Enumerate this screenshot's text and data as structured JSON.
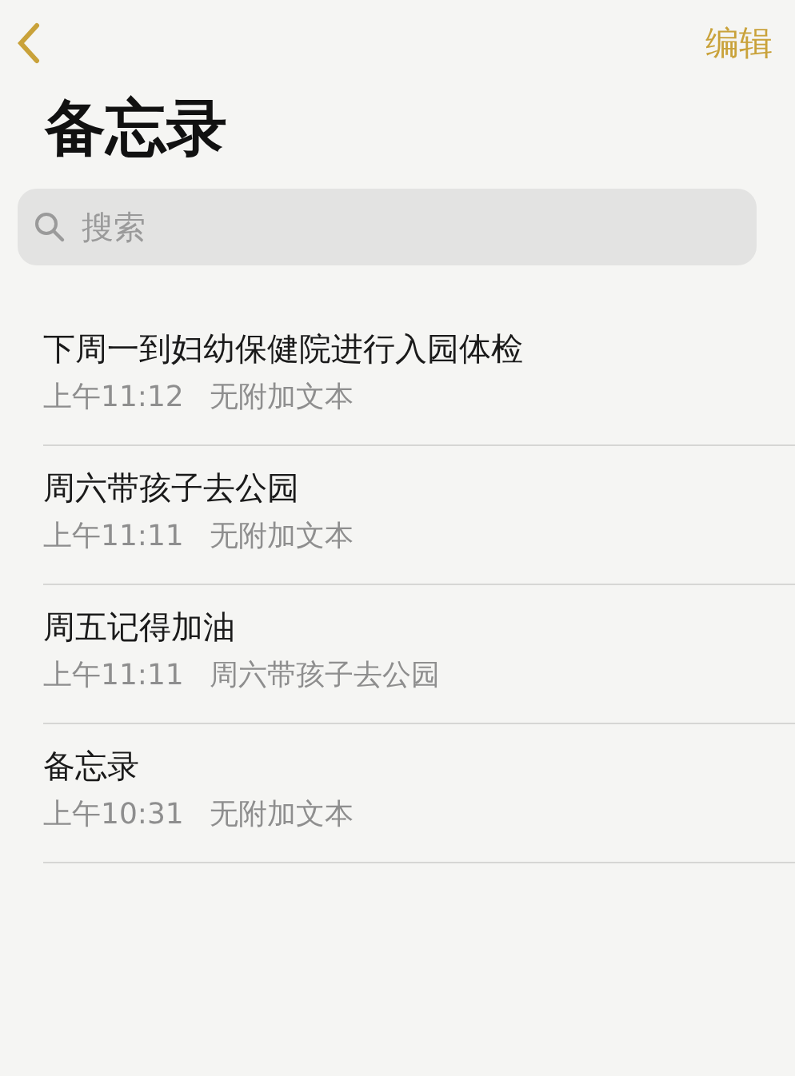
{
  "nav": {
    "edit": "编辑"
  },
  "title": "备忘录",
  "search": {
    "placeholder": "搜索"
  },
  "notes": [
    {
      "title": "下周一到妇幼保健院进行入园体检",
      "time": "上午11:12",
      "preview": "无附加文本"
    },
    {
      "title": "周六带孩子去公园",
      "time": "上午11:11",
      "preview": "无附加文本"
    },
    {
      "title": "周五记得加油",
      "time": "上午11:11",
      "preview": "周六带孩子去公园"
    },
    {
      "title": "备忘录",
      "time": "上午10:31",
      "preview": "无附加文本"
    }
  ]
}
